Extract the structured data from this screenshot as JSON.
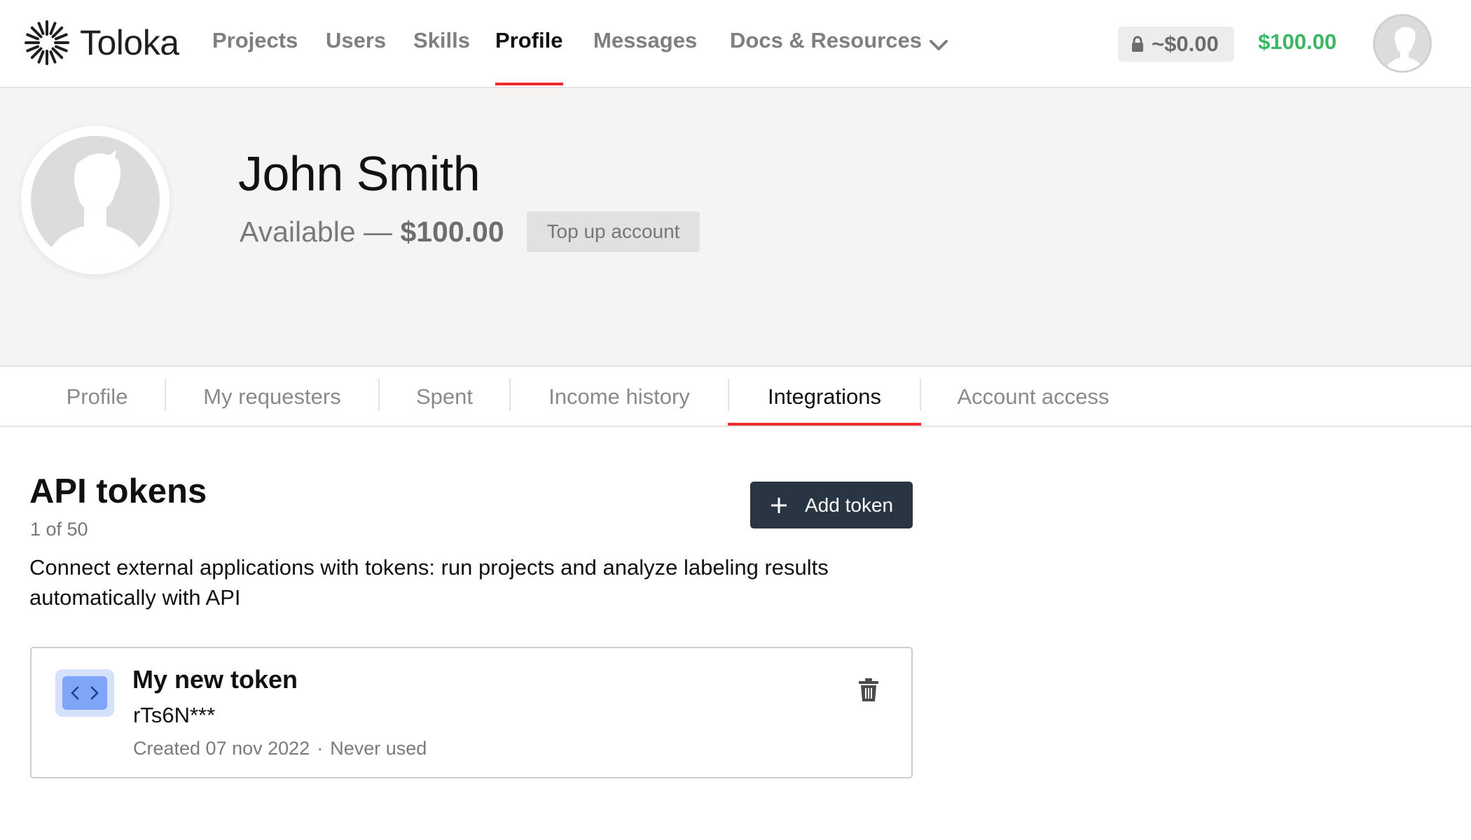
{
  "brand": {
    "name": "Toloka"
  },
  "nav": {
    "items": [
      {
        "label": "Projects"
      },
      {
        "label": "Users"
      },
      {
        "label": "Skills"
      },
      {
        "label": "Profile"
      },
      {
        "label": "Messages"
      },
      {
        "label": "Docs & Resources"
      }
    ],
    "active": "Profile",
    "locked_balance": "~$0.00",
    "balance": "$100.00"
  },
  "profile": {
    "name": "John Smith",
    "available_prefix": "Available — ",
    "available_amount": "$100.00",
    "topup_label": "Top up account"
  },
  "tabs": {
    "items": [
      {
        "label": "Profile"
      },
      {
        "label": "My requesters"
      },
      {
        "label": "Spent"
      },
      {
        "label": "Income history"
      },
      {
        "label": "Integrations"
      },
      {
        "label": "Account access"
      }
    ],
    "active": "Integrations"
  },
  "api_tokens": {
    "title": "API tokens",
    "count": "1 of 50",
    "description": "Connect external applications with tokens: run projects and analyze labeling results automatically with API",
    "add_label": "Add token",
    "tokens": [
      {
        "name": "My new token",
        "value": "rTs6N***",
        "created": "Created 07 nov 2022",
        "separator": "·",
        "usage": "Never used"
      }
    ]
  },
  "colors": {
    "accent_red": "#ef2b2b",
    "balance_green": "#3ab763",
    "primary_dark": "#2a3543",
    "hero_bg": "#f5f4f3"
  }
}
